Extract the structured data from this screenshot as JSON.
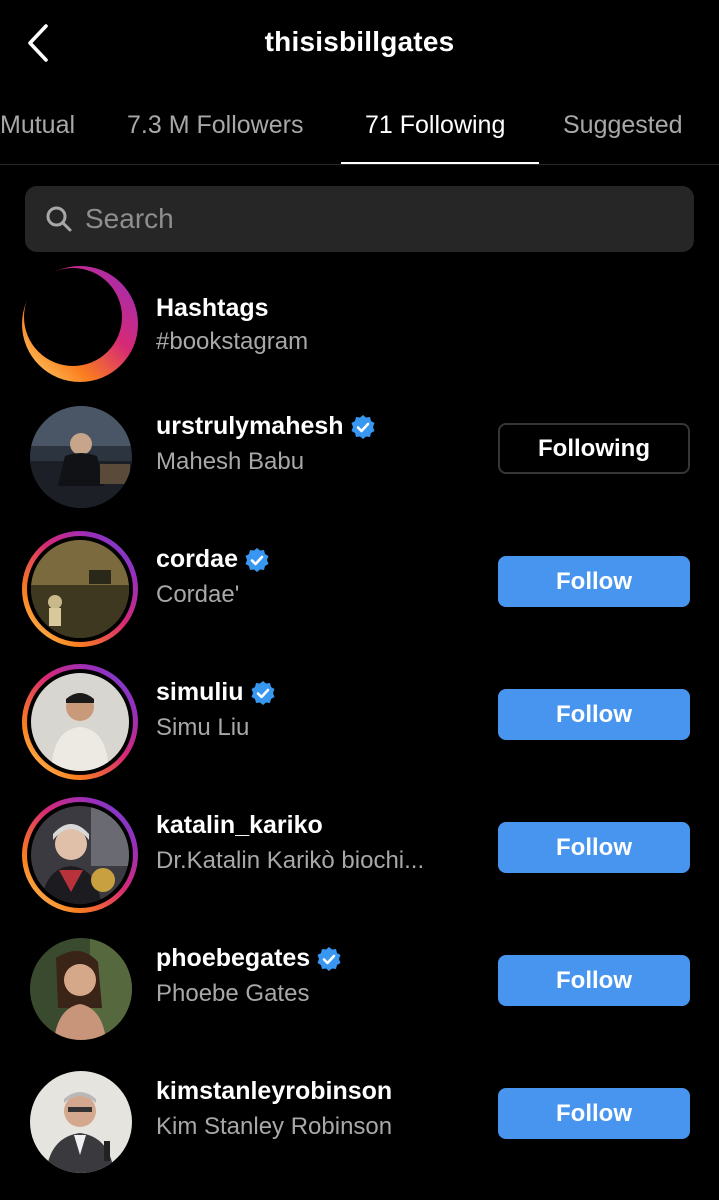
{
  "header": {
    "title": "thisisbillgates",
    "back_icon": "chevron-left-icon"
  },
  "tabs": [
    {
      "label": "Mutual",
      "active": false
    },
    {
      "label": "7.3 M Followers",
      "active": false
    },
    {
      "label": "71 Following",
      "active": true
    },
    {
      "label": "Suggested",
      "active": false
    }
  ],
  "search": {
    "placeholder": "Search",
    "value": "",
    "icon": "search-icon"
  },
  "hashtag_row": {
    "title": "Hashtags",
    "subtitle": "#bookstagram",
    "icon": "hashtag-icon"
  },
  "accounts": [
    {
      "username": "urstrulymahesh",
      "name": "Mahesh Babu",
      "verified": true,
      "story_ring": false,
      "button": "Following"
    },
    {
      "username": "cordae",
      "name": "Cordae'",
      "verified": true,
      "story_ring": true,
      "button": "Follow"
    },
    {
      "username": "simuliu",
      "name": "Simu Liu",
      "verified": true,
      "story_ring": true,
      "button": "Follow"
    },
    {
      "username": "katalin_kariko",
      "name": "Dr.Katalin Karikò biochi...",
      "verified": false,
      "story_ring": true,
      "button": "Follow"
    },
    {
      "username": "phoebegates",
      "name": "Phoebe Gates",
      "verified": true,
      "story_ring": false,
      "button": "Follow"
    },
    {
      "username": "kimstanleyrobinson",
      "name": "Kim Stanley Robinson",
      "verified": false,
      "story_ring": false,
      "button": "Follow"
    }
  ],
  "colors": {
    "background": "#000000",
    "accent_blue": "#4895ef",
    "verified_blue": "#3897f0",
    "secondary_text": "#a8a8a8",
    "search_bg": "#262626"
  }
}
